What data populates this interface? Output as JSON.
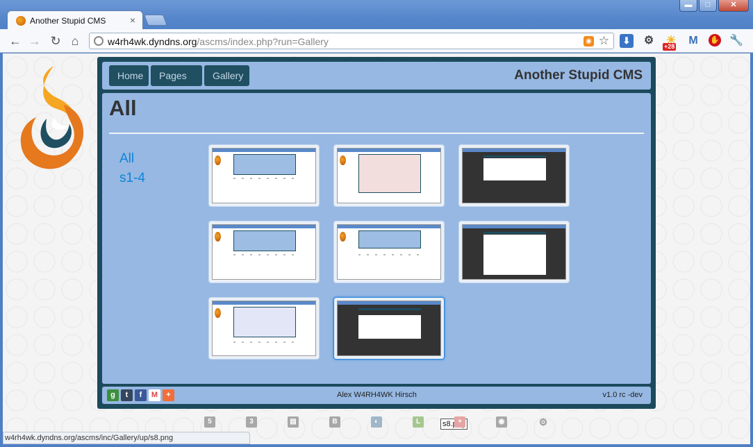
{
  "window": {
    "minimize": "▬",
    "maximize": "□",
    "close": "✕"
  },
  "tab": {
    "title": "Another Stupid CMS",
    "close": "×"
  },
  "toolbar": {
    "back": "←",
    "forward": "→",
    "reload": "↻",
    "home": "⌂",
    "url_host": "w4rh4wk.dyndns.org",
    "url_path": "/ascms/index.php?run=Gallery",
    "weather_badge": "+28"
  },
  "nav": {
    "items": [
      {
        "label": "Home"
      },
      {
        "label": "Pages"
      },
      {
        "label": "Gallery"
      }
    ]
  },
  "site": {
    "title": "Another Stupid CMS"
  },
  "page": {
    "title": "All"
  },
  "categories": [
    {
      "label": "All"
    },
    {
      "label": "s1-4"
    }
  ],
  "gallery": {
    "hover_tooltip": "s8.png"
  },
  "footer": {
    "author": "Alex W4RH4WK Hirsch",
    "version": "v1.0 rc -dev",
    "share_icons": [
      "google-icon",
      "tumblr-icon",
      "facebook-icon",
      "gmail-icon",
      "addthis-icon"
    ]
  },
  "status_bar": {
    "text": "w4rh4wk.dyndns.org/ascms/inc/Gallery/up/s8.png"
  },
  "tech_icons": [
    "html5-icon",
    "css3-icon",
    "javascript-icon",
    "bootstrap-icon",
    "jquery-icon",
    "less-icon",
    "plus-icon",
    "rss-icon",
    "gears-icon"
  ],
  "colors": {
    "panel_dark": "#1c4a5c",
    "panel_light": "#96b8e3",
    "nav_button": "#1f4f60",
    "link": "#0e83d6"
  }
}
